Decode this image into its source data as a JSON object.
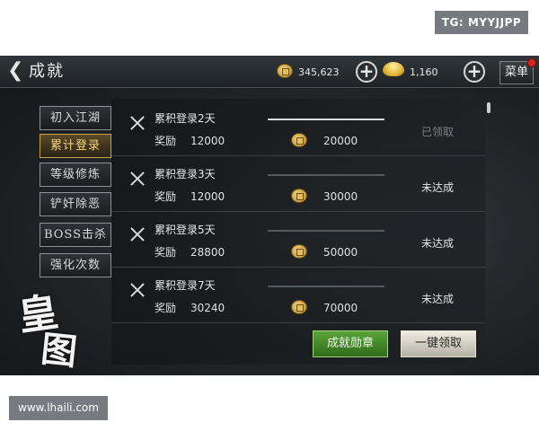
{
  "watermarks": {
    "top": "TG: MYYJJPP",
    "bottom": "www.lhaili.com"
  },
  "header": {
    "title": "成就",
    "copper_amount": "345,623",
    "gold_amount": "1,160",
    "menu_label": "菜单",
    "icons": {
      "back": "chevron-left-icon",
      "copper": "copper-coin-icon",
      "gold": "gold-ingot-icon",
      "add": "plus-icon"
    }
  },
  "sidebar": {
    "tabs": [
      {
        "label": "初入江湖"
      },
      {
        "label": "累计登录",
        "active": true
      },
      {
        "label": "等级修炼"
      },
      {
        "label": "铲奸除恶"
      },
      {
        "label": "BOSS击杀"
      },
      {
        "label": "强化次数"
      }
    ]
  },
  "logo": {
    "chars": [
      "皇",
      "图"
    ]
  },
  "achievements": [
    {
      "title": "累积登录2天",
      "reward_label": "奖励",
      "reward_value": "12000",
      "money": "20000",
      "status": "已领取",
      "claimed": true,
      "progress": 1.0
    },
    {
      "title": "累积登录3天",
      "reward_label": "奖励",
      "reward_value": "12000",
      "money": "30000",
      "status": "未达成",
      "claimed": false,
      "progress": 0.0
    },
    {
      "title": "累积登录5天",
      "reward_label": "奖励",
      "reward_value": "28800",
      "money": "50000",
      "status": "未达成",
      "claimed": false,
      "progress": 0.0
    },
    {
      "title": "累积登录7天",
      "reward_label": "奖励",
      "reward_value": "30240",
      "money": "70000",
      "status": "未达成",
      "claimed": false,
      "progress": 0.0
    }
  ],
  "buttons": {
    "medal": "成就勋章",
    "claim_all": "一键领取"
  },
  "colors": {
    "active_tab": "#caa24a",
    "medal_button": "#59a438",
    "claimed_status": "#7c8084"
  }
}
